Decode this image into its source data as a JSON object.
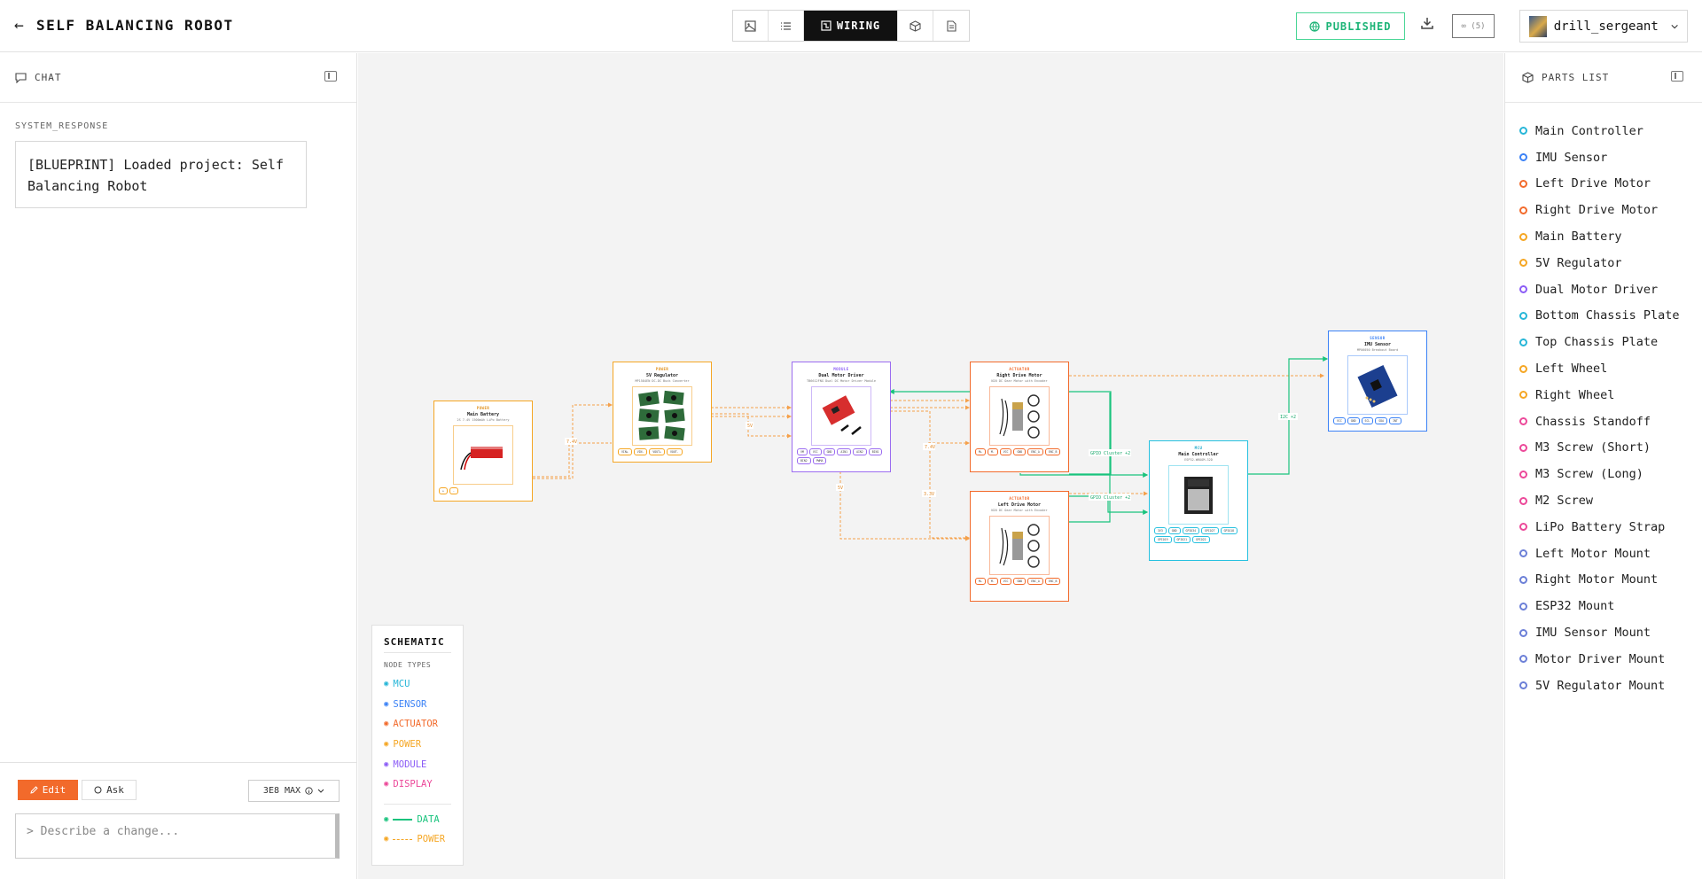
{
  "header": {
    "project_title": "SELF BALANCING ROBOT",
    "active_tab": "WIRING",
    "publish_label": "PUBLISHED",
    "credits": "∞ (5)",
    "username": "drill_sergeant"
  },
  "chat": {
    "title": "CHAT",
    "system_label": "SYSTEM_RESPONSE",
    "system_message": "[BLUEPRINT] Loaded project: Self Balancing Robot",
    "edit_label": "Edit",
    "ask_label": "Ask",
    "model_label": "3E8 MAX",
    "input_placeholder": "> Describe a change..."
  },
  "parts": {
    "title": "PARTS LIST",
    "items": [
      {
        "label": "Main Controller",
        "color": "#27b6d8"
      },
      {
        "label": "IMU Sensor",
        "color": "#3b82f6"
      },
      {
        "label": "Left Drive Motor",
        "color": "#f26a2b"
      },
      {
        "label": "Right Drive Motor",
        "color": "#f26a2b"
      },
      {
        "label": "Main Battery",
        "color": "#f5a623"
      },
      {
        "label": "5V Regulator",
        "color": "#f5a623"
      },
      {
        "label": "Dual Motor Driver",
        "color": "#8b5cf6"
      },
      {
        "label": "Bottom Chassis Plate",
        "color": "#27b6d8"
      },
      {
        "label": "Top Chassis Plate",
        "color": "#27b6d8"
      },
      {
        "label": "Left Wheel",
        "color": "#f5a623"
      },
      {
        "label": "Right Wheel",
        "color": "#f5a623"
      },
      {
        "label": "Chassis Standoff",
        "color": "#ec4899"
      },
      {
        "label": "M3 Screw (Short)",
        "color": "#ec4899"
      },
      {
        "label": "M3 Screw (Long)",
        "color": "#ec4899"
      },
      {
        "label": "M2 Screw",
        "color": "#ec4899"
      },
      {
        "label": "LiPo Battery Strap",
        "color": "#ec4899"
      },
      {
        "label": "Left Motor Mount",
        "color": "#6b7fd7"
      },
      {
        "label": "Right Motor Mount",
        "color": "#6b7fd7"
      },
      {
        "label": "ESP32 Mount",
        "color": "#6b7fd7"
      },
      {
        "label": "IMU Sensor Mount",
        "color": "#6b7fd7"
      },
      {
        "label": "Motor Driver Mount",
        "color": "#6b7fd7"
      },
      {
        "label": "5V Regulator Mount",
        "color": "#6b7fd7"
      }
    ]
  },
  "schematic": {
    "nodes": {
      "battery": {
        "category": "POWER",
        "name": "Main Battery",
        "sub": "2S 7.4V 1500mAh LiPo Battery",
        "pins": [
          "+",
          "-"
        ]
      },
      "regulator": {
        "category": "POWER",
        "name": "5V Regulator",
        "sub": "MP1584EN DC-DC Buck Converter",
        "pins": [
          "VIN+",
          "VIN-",
          "VOUT+",
          "VOUT-"
        ]
      },
      "driver": {
        "category": "MODULE",
        "name": "Dual Motor Driver",
        "sub": "TB6612FNG Dual DC Motor Driver Module",
        "pins": [
          "VM",
          "VCC",
          "GND",
          "AIN1",
          "AIN2",
          "BIN1",
          "BIN2",
          "PWMA"
        ]
      },
      "right_motor": {
        "category": "ACTUATOR",
        "name": "Right Drive Motor",
        "sub": "N20 DC Gear Motor with Encoder",
        "pins": [
          "M+",
          "M-",
          "VCC",
          "GND",
          "ENC_A",
          "ENC_B"
        ]
      },
      "left_motor": {
        "category": "ACTUATOR",
        "name": "Left Drive Motor",
        "sub": "N20 DC Gear Motor with Encoder",
        "pins": [
          "M+",
          "M-",
          "VCC",
          "GND",
          "ENC_A",
          "ENC_B"
        ]
      },
      "controller": {
        "category": "MCU",
        "name": "Main Controller",
        "sub": "ESP32-WROOM-32D",
        "pins": [
          "3V3",
          "GND",
          "GPIO34",
          "GPIO27",
          "GPIO18",
          "GPIO19",
          "GPIO21",
          "GPIO22"
        ]
      },
      "imu": {
        "category": "SENSOR",
        "name": "IMU Sensor",
        "sub": "MPU6050 Breakout Board",
        "pins": [
          "VCC",
          "GND",
          "SCL",
          "SDA",
          "INT"
        ]
      }
    },
    "edge_labels": {
      "battery_reg": "7.4V",
      "reg_driver": "5V",
      "driver_motor": "7.4V",
      "driver_down": "5V",
      "mid_down": "3.3V",
      "gpio_upper": "GPIO Cluster +2",
      "gpio_lower": "GPIO Cluster +2",
      "i2c": "I2C +2"
    }
  },
  "legend": {
    "title": "SCHEMATIC",
    "subtitle": "NODE TYPES",
    "types": [
      {
        "label": "MCU",
        "color": "#27b6d8"
      },
      {
        "label": "SENSOR",
        "color": "#3b82f6"
      },
      {
        "label": "ACTUATOR",
        "color": "#f26a2b"
      },
      {
        "label": "POWER",
        "color": "#f5a623"
      },
      {
        "label": "MODULE",
        "color": "#8b5cf6"
      },
      {
        "label": "DISPLAY",
        "color": "#ec4899"
      }
    ],
    "data_label": "DATA",
    "power_label": "POWER"
  }
}
